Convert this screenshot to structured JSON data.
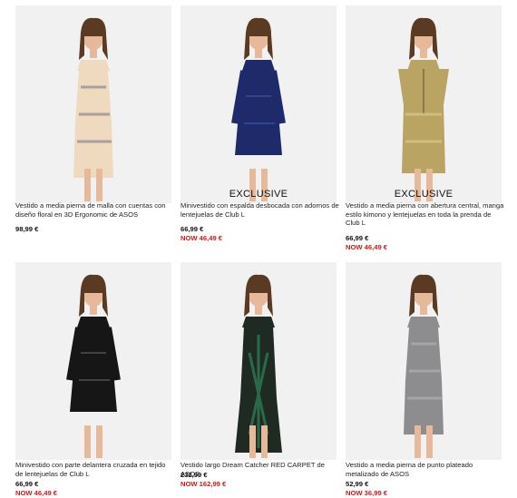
{
  "products": [
    {
      "description": "Vestido a media pierna de malla con cuentas con diseño floral en 3D Ergonomic de ASOS",
      "price": "98,99 €",
      "sale_price": "",
      "badge": "",
      "dress_color": "#efd9bf",
      "accent_color": "#7c7a8a"
    },
    {
      "description": "Minivestido con espalda desbocada con adornos de lentejuelas de Club L",
      "price": "66,99 €",
      "sale_price": "NOW 46,49 €",
      "badge": "EXCLUSIVE",
      "dress_color": "#1f2a6b",
      "accent_color": "#3b4fa2"
    },
    {
      "description": "Vestido a media pierna con abertura central, manga estilo kimono y lentejuelas en toda la prenda de Club L",
      "price": "66,99 €",
      "sale_price": "NOW 46,49 €",
      "badge": "EXCLUSIVE",
      "dress_color": "#b9a464",
      "accent_color": "#d8c98c"
    },
    {
      "description": "Minivestido con parte delantera cruzada en tejido de lentejuelas de Club L",
      "price": "66,99 €",
      "sale_price": "NOW 46,49 €",
      "badge": "",
      "dress_color": "#161616",
      "accent_color": "#555555"
    },
    {
      "description": "Vestido largo Dream Catcher RED CARPET de ASOS",
      "price": "232,99 €",
      "sale_price": "NOW 162,99 €",
      "badge": "",
      "dress_color": "#1f2a22",
      "accent_color": "#2f7a52"
    },
    {
      "description": "Vestido a media pierna de punto plateado metalizado de ASOS",
      "price": "52,99 €",
      "sale_price": "NOW 36,99 €",
      "badge": "",
      "dress_color": "#8d8d8f",
      "accent_color": "#b5b5b7"
    }
  ],
  "colors": {
    "sale": "#d01616",
    "photo_background": "#f1f1f1",
    "skin": "#e6b99a",
    "hair": "#5a3a22"
  }
}
